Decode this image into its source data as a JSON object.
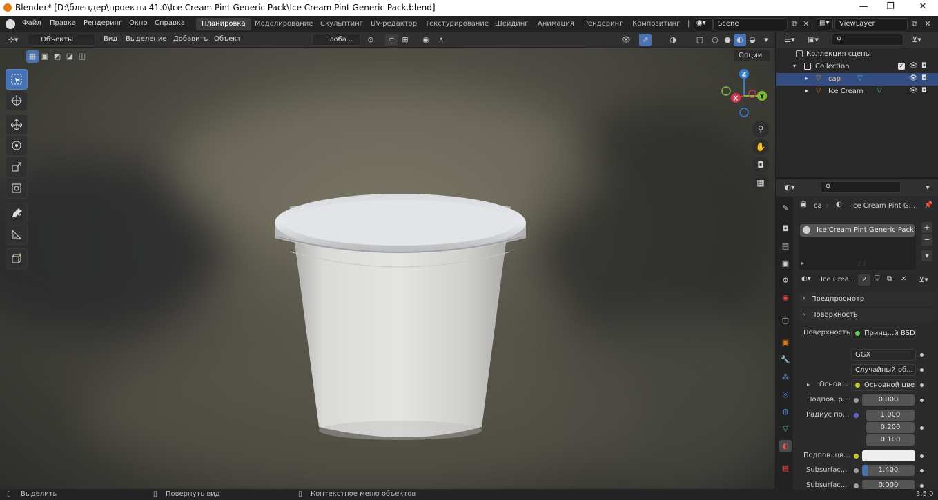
{
  "window": {
    "title": "Blender* [D:\\блендер\\проекты 41.0\\Ice Cream Pint Generic Pack\\Ice Cream Pint Generic Pack.blend]",
    "min": "—",
    "max": "❐",
    "close": "✕"
  },
  "menu": [
    "Файл",
    "Правка",
    "Рендеринг",
    "Окно",
    "Справка"
  ],
  "workspaces": [
    "Планировка",
    "Моделирование",
    "Скульптинг",
    "UV-редактор",
    "Текстурирование",
    "Шейдинг",
    "Анимация",
    "Рендеринг",
    "Композитинг",
    "|"
  ],
  "scene": {
    "label": "Scene",
    "viewlayer": "ViewLayer"
  },
  "viewport": {
    "mode": "Объекты",
    "menus": [
      "Вид",
      "Выделение",
      "Добавить",
      "Объект"
    ],
    "orientation": "Глоба...",
    "options": "Опции"
  },
  "gizmo": {
    "z": "Z",
    "y": "Y",
    "x": "X"
  },
  "outliner": {
    "scene_collection": "Коллекция сцены",
    "collection": "Collection",
    "items": [
      "cap",
      "Ice Cream"
    ]
  },
  "properties": {
    "breadcrumb_obj": "ca",
    "breadcrumb_mat": "Ice Cream Pint G...",
    "slot": "Ice Cream Pint Generic Pack",
    "material_name": "Ice Crea...",
    "users": "2",
    "sections": {
      "preview": "Предпросмотр",
      "surface": "Поверхность"
    },
    "surface_label": "Поверхность",
    "surface_value": "Принц...й BSDF",
    "distribution": "GGX",
    "subsurface_method": "Случайный об...",
    "rows": [
      {
        "label": "Основ...",
        "value": "Основной цвет"
      },
      {
        "label": "Подпов. р...",
        "value": "0.000"
      },
      {
        "label": "Радиус по...",
        "values": [
          "1.000",
          "0.200",
          "0.100"
        ]
      },
      {
        "label": "Подпов. цв...",
        "value": ""
      },
      {
        "label": "Subsurfac...",
        "value": "1.400"
      },
      {
        "label": "Subsurfac...",
        "value": "0.000"
      }
    ]
  },
  "status": {
    "select": "Выделить",
    "rotate": "Повернуть вид",
    "context": "Контекстное меню объектов",
    "version": "3.5.0"
  },
  "colors": {
    "accent": "#4772b3",
    "orange": "#e87d0d",
    "selected_row": "#334d80"
  }
}
